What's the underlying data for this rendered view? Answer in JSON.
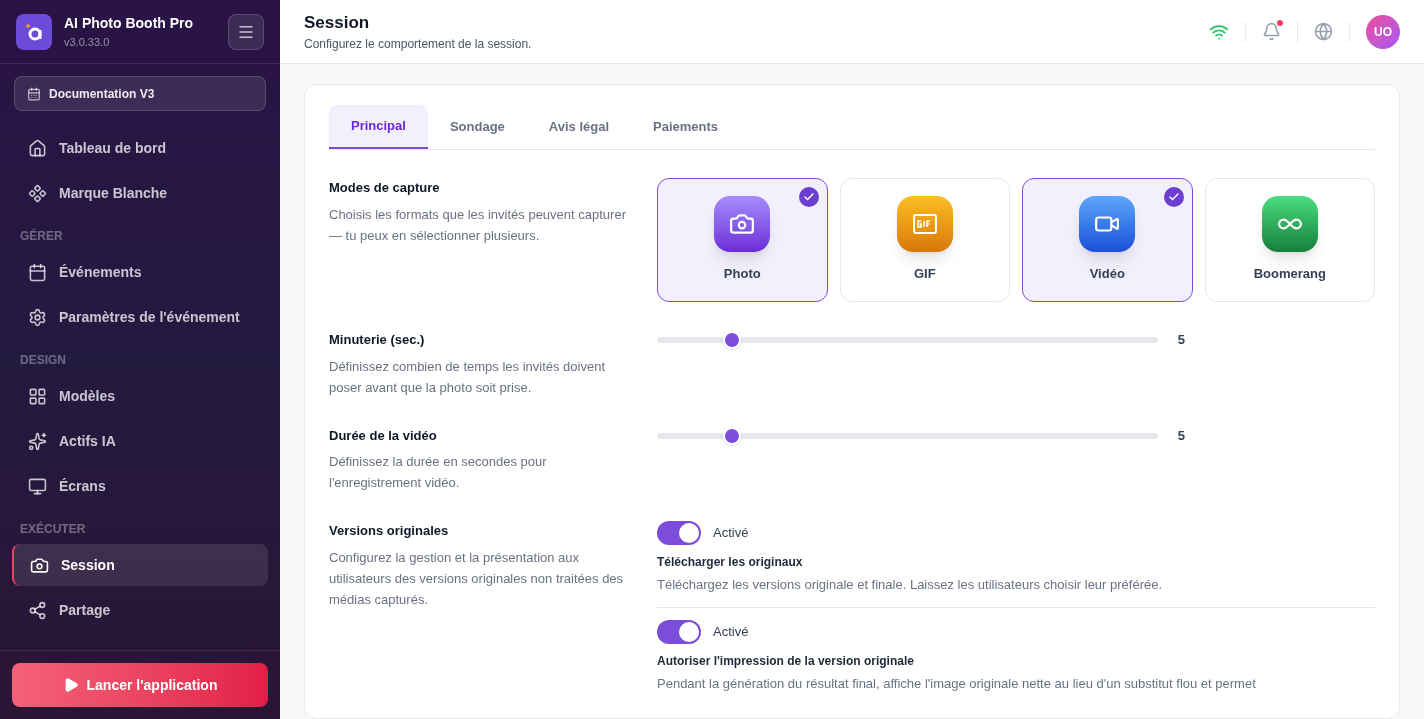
{
  "app": {
    "name": "AI Photo Booth Pro",
    "version": "v3.0.33.0"
  },
  "event_button": "Documentation V3",
  "nav": [
    {
      "kind": "item",
      "label": "Tableau de bord",
      "selected": false
    },
    {
      "kind": "item",
      "label": "Marque Blanche",
      "selected": false
    },
    {
      "kind": "heading",
      "label": "GÉRER"
    },
    {
      "kind": "item",
      "label": "Événements",
      "selected": false
    },
    {
      "kind": "item",
      "label": "Paramètres de l'événement",
      "selected": false
    },
    {
      "kind": "heading",
      "label": "DESIGN"
    },
    {
      "kind": "item",
      "label": "Modèles",
      "selected": false
    },
    {
      "kind": "item",
      "label": "Actifs IA",
      "selected": false
    },
    {
      "kind": "item",
      "label": "Écrans",
      "selected": false
    },
    {
      "kind": "heading",
      "label": "EXÉCUTER"
    },
    {
      "kind": "item",
      "label": "Session",
      "selected": true
    },
    {
      "kind": "item",
      "label": "Partage",
      "selected": false
    }
  ],
  "launch_button": "Lancer l'application",
  "header": {
    "title": "Session",
    "subtitle": "Configurez le comportement de la session.",
    "notification_dot": true,
    "avatar": "UO"
  },
  "tabs": [
    {
      "label": "Principal",
      "selected": true
    },
    {
      "label": "Sondage",
      "selected": false
    },
    {
      "label": "Avis légal",
      "selected": false
    },
    {
      "label": "Paiements",
      "selected": false
    }
  ],
  "sections": [
    {
      "kind": "modes",
      "title": "Modes de capture",
      "description": "Choisis les formats que les invités peuvent capturer — tu peux en sélectionner plusieurs.",
      "options": [
        {
          "kind": "photo",
          "label": "Photo",
          "selected": true
        },
        {
          "kind": "gif",
          "label": "GIF",
          "selected": false
        },
        {
          "kind": "video",
          "label": "Vidéo",
          "selected": true
        },
        {
          "kind": "boomerang",
          "label": "Boomerang",
          "selected": false
        }
      ]
    },
    {
      "kind": "slider",
      "title": "Minuterie (sec.)",
      "description": "Définissez combien de temps les invités doivent poser avant que la photo soit prise.",
      "level": 0.15,
      "reading": "5"
    },
    {
      "kind": "slider",
      "title": "Durée de la vidéo",
      "description": "Définissez la durée en secondes pour l'enregistrement vidéo.",
      "level": 0.15,
      "reading": "5"
    },
    {
      "kind": "toggles",
      "title": "Versions originales",
      "description": "Configurez la gestion et la présentation aux utilisateurs des versions originales non traitées des médias capturés.",
      "toggles": [
        {
          "on": true,
          "state_label": "Activé",
          "title": "Télécharger les originaux",
          "description": "Téléchargez les versions originale et finale. Laissez les utilisateurs choisir leur préférée."
        },
        {
          "on": true,
          "state_label": "Activé",
          "title": "Autoriser l'impression de la version originale",
          "description": "Pendant la génération du résultat final, affiche l'image originale nette au lieu d'un substitut flou et permet"
        }
      ]
    }
  ]
}
